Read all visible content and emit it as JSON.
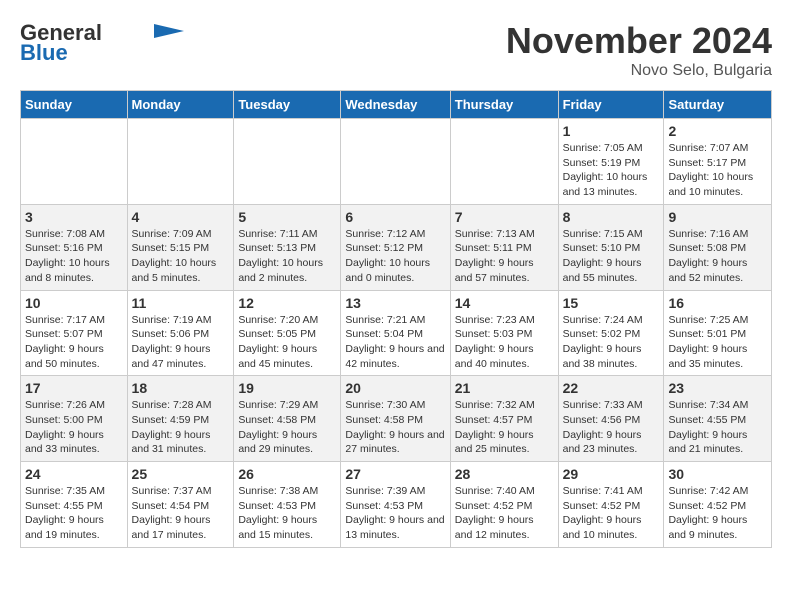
{
  "logo": {
    "line1": "General",
    "line2": "Blue",
    "arrow": "▶"
  },
  "title": "November 2024",
  "location": "Novo Selo, Bulgaria",
  "weekdays": [
    "Sunday",
    "Monday",
    "Tuesday",
    "Wednesday",
    "Thursday",
    "Friday",
    "Saturday"
  ],
  "weeks": [
    [
      {
        "day": "",
        "info": ""
      },
      {
        "day": "",
        "info": ""
      },
      {
        "day": "",
        "info": ""
      },
      {
        "day": "",
        "info": ""
      },
      {
        "day": "",
        "info": ""
      },
      {
        "day": "1",
        "info": "Sunrise: 7:05 AM\nSunset: 5:19 PM\nDaylight: 10 hours and 13 minutes."
      },
      {
        "day": "2",
        "info": "Sunrise: 7:07 AM\nSunset: 5:17 PM\nDaylight: 10 hours and 10 minutes."
      }
    ],
    [
      {
        "day": "3",
        "info": "Sunrise: 7:08 AM\nSunset: 5:16 PM\nDaylight: 10 hours and 8 minutes."
      },
      {
        "day": "4",
        "info": "Sunrise: 7:09 AM\nSunset: 5:15 PM\nDaylight: 10 hours and 5 minutes."
      },
      {
        "day": "5",
        "info": "Sunrise: 7:11 AM\nSunset: 5:13 PM\nDaylight: 10 hours and 2 minutes."
      },
      {
        "day": "6",
        "info": "Sunrise: 7:12 AM\nSunset: 5:12 PM\nDaylight: 10 hours and 0 minutes."
      },
      {
        "day": "7",
        "info": "Sunrise: 7:13 AM\nSunset: 5:11 PM\nDaylight: 9 hours and 57 minutes."
      },
      {
        "day": "8",
        "info": "Sunrise: 7:15 AM\nSunset: 5:10 PM\nDaylight: 9 hours and 55 minutes."
      },
      {
        "day": "9",
        "info": "Sunrise: 7:16 AM\nSunset: 5:08 PM\nDaylight: 9 hours and 52 minutes."
      }
    ],
    [
      {
        "day": "10",
        "info": "Sunrise: 7:17 AM\nSunset: 5:07 PM\nDaylight: 9 hours and 50 minutes."
      },
      {
        "day": "11",
        "info": "Sunrise: 7:19 AM\nSunset: 5:06 PM\nDaylight: 9 hours and 47 minutes."
      },
      {
        "day": "12",
        "info": "Sunrise: 7:20 AM\nSunset: 5:05 PM\nDaylight: 9 hours and 45 minutes."
      },
      {
        "day": "13",
        "info": "Sunrise: 7:21 AM\nSunset: 5:04 PM\nDaylight: 9 hours and 42 minutes."
      },
      {
        "day": "14",
        "info": "Sunrise: 7:23 AM\nSunset: 5:03 PM\nDaylight: 9 hours and 40 minutes."
      },
      {
        "day": "15",
        "info": "Sunrise: 7:24 AM\nSunset: 5:02 PM\nDaylight: 9 hours and 38 minutes."
      },
      {
        "day": "16",
        "info": "Sunrise: 7:25 AM\nSunset: 5:01 PM\nDaylight: 9 hours and 35 minutes."
      }
    ],
    [
      {
        "day": "17",
        "info": "Sunrise: 7:26 AM\nSunset: 5:00 PM\nDaylight: 9 hours and 33 minutes."
      },
      {
        "day": "18",
        "info": "Sunrise: 7:28 AM\nSunset: 4:59 PM\nDaylight: 9 hours and 31 minutes."
      },
      {
        "day": "19",
        "info": "Sunrise: 7:29 AM\nSunset: 4:58 PM\nDaylight: 9 hours and 29 minutes."
      },
      {
        "day": "20",
        "info": "Sunrise: 7:30 AM\nSunset: 4:58 PM\nDaylight: 9 hours and 27 minutes."
      },
      {
        "day": "21",
        "info": "Sunrise: 7:32 AM\nSunset: 4:57 PM\nDaylight: 9 hours and 25 minutes."
      },
      {
        "day": "22",
        "info": "Sunrise: 7:33 AM\nSunset: 4:56 PM\nDaylight: 9 hours and 23 minutes."
      },
      {
        "day": "23",
        "info": "Sunrise: 7:34 AM\nSunset: 4:55 PM\nDaylight: 9 hours and 21 minutes."
      }
    ],
    [
      {
        "day": "24",
        "info": "Sunrise: 7:35 AM\nSunset: 4:55 PM\nDaylight: 9 hours and 19 minutes."
      },
      {
        "day": "25",
        "info": "Sunrise: 7:37 AM\nSunset: 4:54 PM\nDaylight: 9 hours and 17 minutes."
      },
      {
        "day": "26",
        "info": "Sunrise: 7:38 AM\nSunset: 4:53 PM\nDaylight: 9 hours and 15 minutes."
      },
      {
        "day": "27",
        "info": "Sunrise: 7:39 AM\nSunset: 4:53 PM\nDaylight: 9 hours and 13 minutes."
      },
      {
        "day": "28",
        "info": "Sunrise: 7:40 AM\nSunset: 4:52 PM\nDaylight: 9 hours and 12 minutes."
      },
      {
        "day": "29",
        "info": "Sunrise: 7:41 AM\nSunset: 4:52 PM\nDaylight: 9 hours and 10 minutes."
      },
      {
        "day": "30",
        "info": "Sunrise: 7:42 AM\nSunset: 4:52 PM\nDaylight: 9 hours and 9 minutes."
      }
    ]
  ]
}
